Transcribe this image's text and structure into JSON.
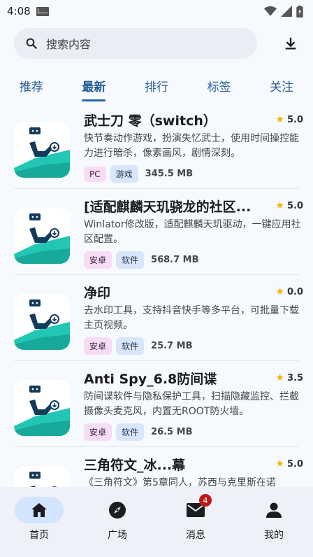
{
  "status": {
    "time": "4:08"
  },
  "search": {
    "placeholder": "搜索内容"
  },
  "tabs": [
    {
      "label": "推荐",
      "active": false
    },
    {
      "label": "最新",
      "active": true
    },
    {
      "label": "排行",
      "active": false
    },
    {
      "label": "标签",
      "active": false
    },
    {
      "label": "关注",
      "active": false
    }
  ],
  "apps": [
    {
      "title": "武士刀 零（switch）",
      "rating": "5.0",
      "desc": "快节奏动作游戏，扮演失忆武士，使用时间操控能力进行暗杀，像素画风，剧情深刻。",
      "tags": [
        "PC",
        "游戏"
      ],
      "size": "345.5 MB"
    },
    {
      "title": "[适配麒麟天玑骁龙的社区...",
      "rating": "5.0",
      "desc": "Winlator修改版，适配麒麟天玑驱动，一键应用社区配置。",
      "tags": [
        "安卓",
        "软件"
      ],
      "size": "568.7 MB"
    },
    {
      "title": "净印",
      "rating": "0.0",
      "desc": "去水印工具，支持抖音快手等多平台，可批量下载主页视频。",
      "tags": [
        "安卓",
        "软件"
      ],
      "size": "25.7 MB"
    },
    {
      "title": "Anti Spy_6.8防间谍",
      "rating": "3.5",
      "desc": "防间谍软件与隐私保护工具，扫描隐藏监控、拦截摄像头麦克风，内置无ROOT防火墙。",
      "tags": [
        "安卓",
        "软件"
      ],
      "size": "26.5 MB"
    },
    {
      "title": "三角符文_冰...幕",
      "rating": "5.0",
      "desc": "《三角符文》第5章同人，苏西与克里斯在诺",
      "tags": [],
      "size": ""
    }
  ],
  "nav": [
    {
      "label": "首页",
      "icon": "home-icon",
      "active": true,
      "badge": ""
    },
    {
      "label": "广场",
      "icon": "compass-icon",
      "active": false,
      "badge": ""
    },
    {
      "label": "消息",
      "icon": "mail-icon",
      "active": false,
      "badge": "4"
    },
    {
      "label": "我的",
      "icon": "person-icon",
      "active": false,
      "badge": ""
    }
  ],
  "colors": {
    "accent": "#2a67a8",
    "star": "#f4b400",
    "badge": "#ba1a1a"
  }
}
